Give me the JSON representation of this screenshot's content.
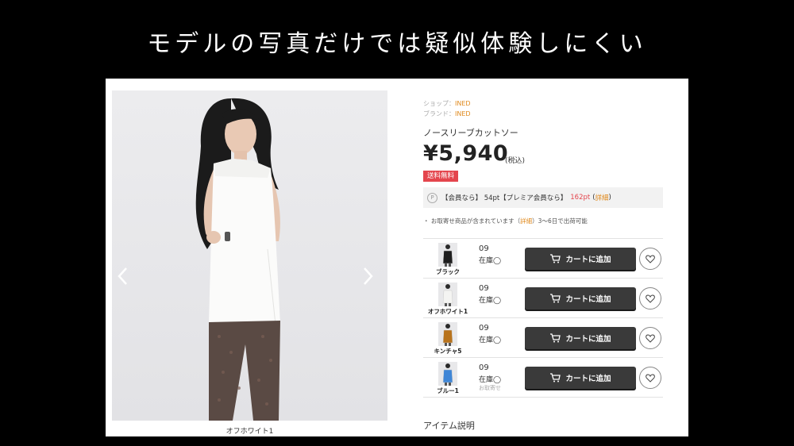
{
  "slide": {
    "title": "モデルの写真だけでは疑似体験しにくい"
  },
  "product": {
    "shop_label": "ショップ：",
    "shop_value": "INED",
    "brand_label": "ブランド：",
    "brand_value": "INED",
    "name": "ノースリーブカットソー",
    "price": "¥5,940",
    "tax_note": "(税込)",
    "shipping_badge": "送料無料",
    "image_caption": "オフホワイト1"
  },
  "points": {
    "icon": "P",
    "member_text": "【会員なら】 54pt【プレミア会員なら】",
    "premium_pt": "162pt",
    "detail_open": "(",
    "detail_link": "詳細",
    "detail_close": ")"
  },
  "notice": {
    "prefix": "・ お取寄せ商品が含まれています（",
    "link": "詳細",
    "suffix": "）3～6日で出荷可能"
  },
  "variants": [
    {
      "color": "ブラック",
      "size": "09",
      "stock": "在庫◯",
      "restock": "",
      "thumb_color": "#1e1e1e",
      "cart_label": "カートに追加"
    },
    {
      "color": "オフホワイト1",
      "size": "09",
      "stock": "在庫◯",
      "restock": "",
      "thumb_color": "#f4f4f2",
      "cart_label": "カートに追加"
    },
    {
      "color": "キンチャ5",
      "size": "09",
      "stock": "在庫◯",
      "restock": "",
      "thumb_color": "#b8731c",
      "cart_label": "カートに追加"
    },
    {
      "color": "ブルー1",
      "size": "09",
      "stock": "在庫◯",
      "restock": "お取寄せ",
      "thumb_color": "#3f86d6",
      "cart_label": "カートに追加"
    }
  ],
  "section": {
    "item_description": "アイテム説明"
  },
  "icons": {
    "prev": "chevron-left-icon",
    "next": "chevron-right-icon",
    "cart": "cart-icon",
    "favorite": "heart-icon",
    "point": "point-icon"
  },
  "colors": {
    "accent_orange": "#e08a1e",
    "badge_red": "#e4454d",
    "button_dark": "#3a3a3a"
  }
}
